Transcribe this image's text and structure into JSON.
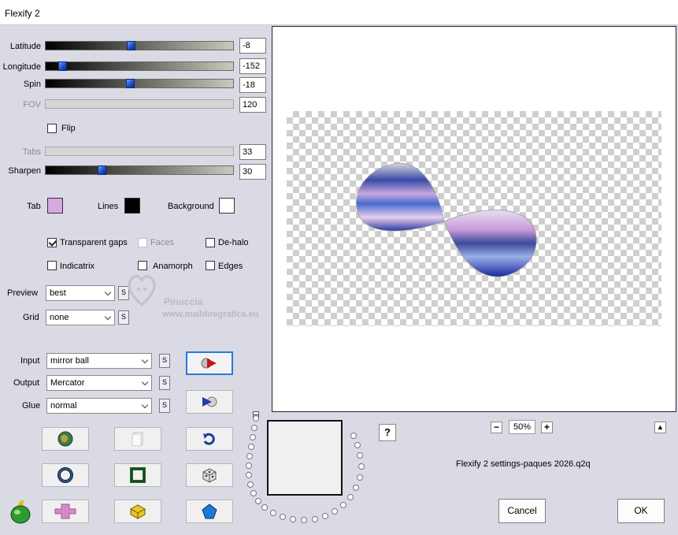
{
  "window": {
    "title": "Flexify 2"
  },
  "sliders": {
    "latitude": {
      "label": "Latitude",
      "value": "-8",
      "fraction": 0.48
    },
    "longitude": {
      "label": "Longitude",
      "value": "-152",
      "fraction": 0.08
    },
    "spin": {
      "label": "Spin",
      "value": "-18",
      "fraction": 0.45
    },
    "fov": {
      "label": "FOV",
      "value": "120",
      "disabled": true
    },
    "tabs": {
      "label": "Tabs",
      "value": "33",
      "disabled": true
    },
    "sharpen": {
      "label": "Sharpen",
      "value": "30",
      "fraction": 0.3
    }
  },
  "flip": {
    "label": "Flip",
    "checked": false
  },
  "colors": {
    "tab": {
      "label": "Tab",
      "color": "#d8a8e0"
    },
    "lines": {
      "label": "Lines",
      "color": "#000000"
    },
    "background": {
      "label": "Background",
      "color": "#ffffff"
    }
  },
  "options": {
    "transparent_gaps": {
      "label": "Transparent gaps",
      "checked": true
    },
    "faces": {
      "label": "Faces",
      "checked": false,
      "disabled": true
    },
    "de_halo": {
      "label": "De-halo",
      "checked": false
    },
    "indicatrix": {
      "label": "Indicatrix",
      "checked": false
    },
    "anamorph": {
      "label": "Anamorph",
      "checked": false
    },
    "edges": {
      "label": "Edges",
      "checked": false
    }
  },
  "preview": {
    "label": "Preview",
    "value": "best"
  },
  "grid": {
    "label": "Grid",
    "value": "none"
  },
  "input": {
    "label": "Input",
    "value": "mirror ball"
  },
  "output": {
    "label": "Output",
    "value": "Mercator"
  },
  "glue": {
    "label": "Glue",
    "value": "normal"
  },
  "s_button_label": "S",
  "watermark": {
    "name": "Pinuccia",
    "url": "www.maildiregrafica.eu"
  },
  "zoom": {
    "value": "50%",
    "minus": "−",
    "plus": "+"
  },
  "help_label": "?",
  "settings_file": "Flexify 2 settings-paques 2026.q2q",
  "buttons": {
    "cancel": "Cancel",
    "ok": "OK"
  },
  "accent_color": "#2a78d8"
}
